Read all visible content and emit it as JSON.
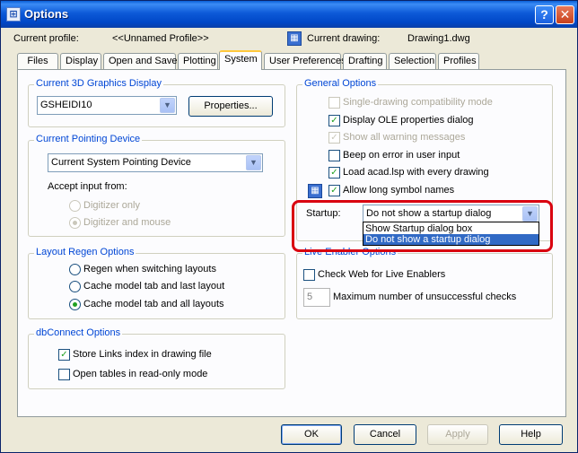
{
  "window": {
    "title": "Options"
  },
  "header": {
    "current_profile_label": "Current profile:",
    "current_profile_value": "<<Unnamed Profile>>",
    "current_drawing_label": "Current drawing:",
    "current_drawing_value": "Drawing1.dwg"
  },
  "tabs": [
    {
      "label": "Files"
    },
    {
      "label": "Display"
    },
    {
      "label": "Open and Save"
    },
    {
      "label": "Plotting"
    },
    {
      "label": "System"
    },
    {
      "label": "User Preferences"
    },
    {
      "label": "Drafting"
    },
    {
      "label": "Selection"
    },
    {
      "label": "Profiles"
    }
  ],
  "graphics": {
    "title": "Current 3D Graphics Display",
    "value": "GSHEIDI10",
    "properties_label": "Properties..."
  },
  "pointing": {
    "title": "Current Pointing Device",
    "value": "Current System Pointing Device",
    "accept_label": "Accept input from:",
    "digitizer_only": "Digitizer only",
    "digitizer_mouse": "Digitizer and mouse"
  },
  "regen": {
    "title": "Layout Regen Options",
    "option1": "Regen when switching layouts",
    "option2": "Cache model tab and last layout",
    "option3": "Cache model tab and all layouts"
  },
  "dbconnect": {
    "title": "dbConnect Options",
    "store_links": "Store Links index in drawing file",
    "open_readonly": "Open tables in read-only mode"
  },
  "general": {
    "title": "General Options",
    "single_drawing": "Single-drawing compatibility mode",
    "display_ole": "Display OLE properties dialog",
    "show_warnings": "Show all warning messages",
    "beep": "Beep on error in user input",
    "load_acad": "Load acad.lsp with every drawing",
    "long_symbols": "Allow long symbol names",
    "startup_label": "Startup:",
    "startup_value": "Do not show a startup dialog",
    "startup_options": [
      "Show Startup dialog box",
      "Do not show a startup dialog"
    ]
  },
  "live_enabler": {
    "title": "Live Enabler Options",
    "check_web": "Check Web for Live Enablers",
    "max_checks_value": "5",
    "max_checks_label": "Maximum number of unsuccessful checks"
  },
  "buttons": {
    "ok": "OK",
    "cancel": "Cancel",
    "apply": "Apply",
    "help": "Help"
  },
  "icons": {
    "check_mark": "✓",
    "dropdown_arrow": "▼",
    "help_glyph": "?",
    "close_glyph": "✕"
  },
  "colors": {
    "group_title": "#0046d5",
    "titlebar": "#0047c7",
    "highlight_ring": "#d9000f",
    "selected_item": "#316ac5"
  }
}
